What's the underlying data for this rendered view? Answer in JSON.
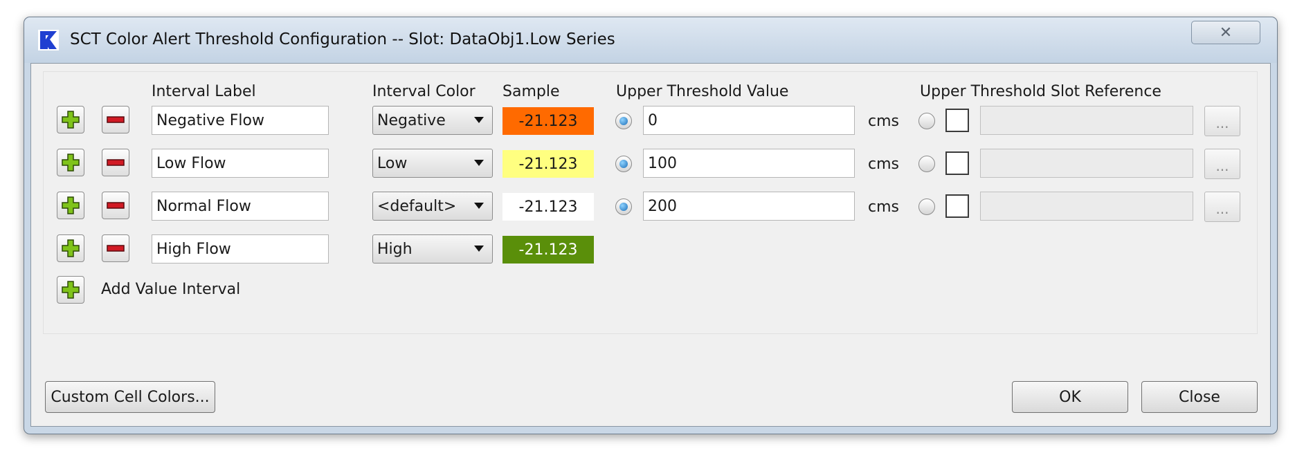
{
  "window": {
    "title": "SCT Color Alert Threshold Configuration -- Slot: DataObj1.Low Series",
    "close_glyph": "✕",
    "app_icon": "riverware-r-logo"
  },
  "headers": {
    "interval_label": "Interval Label",
    "interval_color": "Interval Color",
    "sample": "Sample",
    "upper_threshold_value": "Upper Threshold Value",
    "upper_threshold_slot_reference": "Upper Threshold Slot Reference"
  },
  "rows": [
    {
      "label": "Negative Flow",
      "color": "Negative",
      "sample": "-21.123",
      "sample_bg": "#ff6a00",
      "sample_fg": "#1a1a1a",
      "threshold": "0",
      "unit": "cms",
      "value_selected": true,
      "dots": "..."
    },
    {
      "label": "Low Flow",
      "color": "Low",
      "sample": "-21.123",
      "sample_bg": "#ffff80",
      "sample_fg": "#1a1a1a",
      "threshold": "100",
      "unit": "cms",
      "value_selected": true,
      "dots": "..."
    },
    {
      "label": "Normal Flow",
      "color": "<default>",
      "sample": "-21.123",
      "sample_bg": "#ffffff",
      "sample_fg": "#1a1a1a",
      "threshold": "200",
      "unit": "cms",
      "value_selected": true,
      "dots": "..."
    },
    {
      "label": "High Flow",
      "color": "High",
      "sample": "-21.123",
      "sample_bg": "#5a8f0a",
      "sample_fg": "#ffffff"
    }
  ],
  "add_interval": {
    "label": "Add Value Interval",
    "icon": "plus-icon"
  },
  "buttons": {
    "custom_cell_colors": "Custom Cell Colors...",
    "ok": "OK",
    "close": "Close"
  },
  "colors": {
    "plus_icon": "#7fc31a",
    "minus_icon": "#d11a24",
    "radio_selected": "#1d6fb8"
  }
}
